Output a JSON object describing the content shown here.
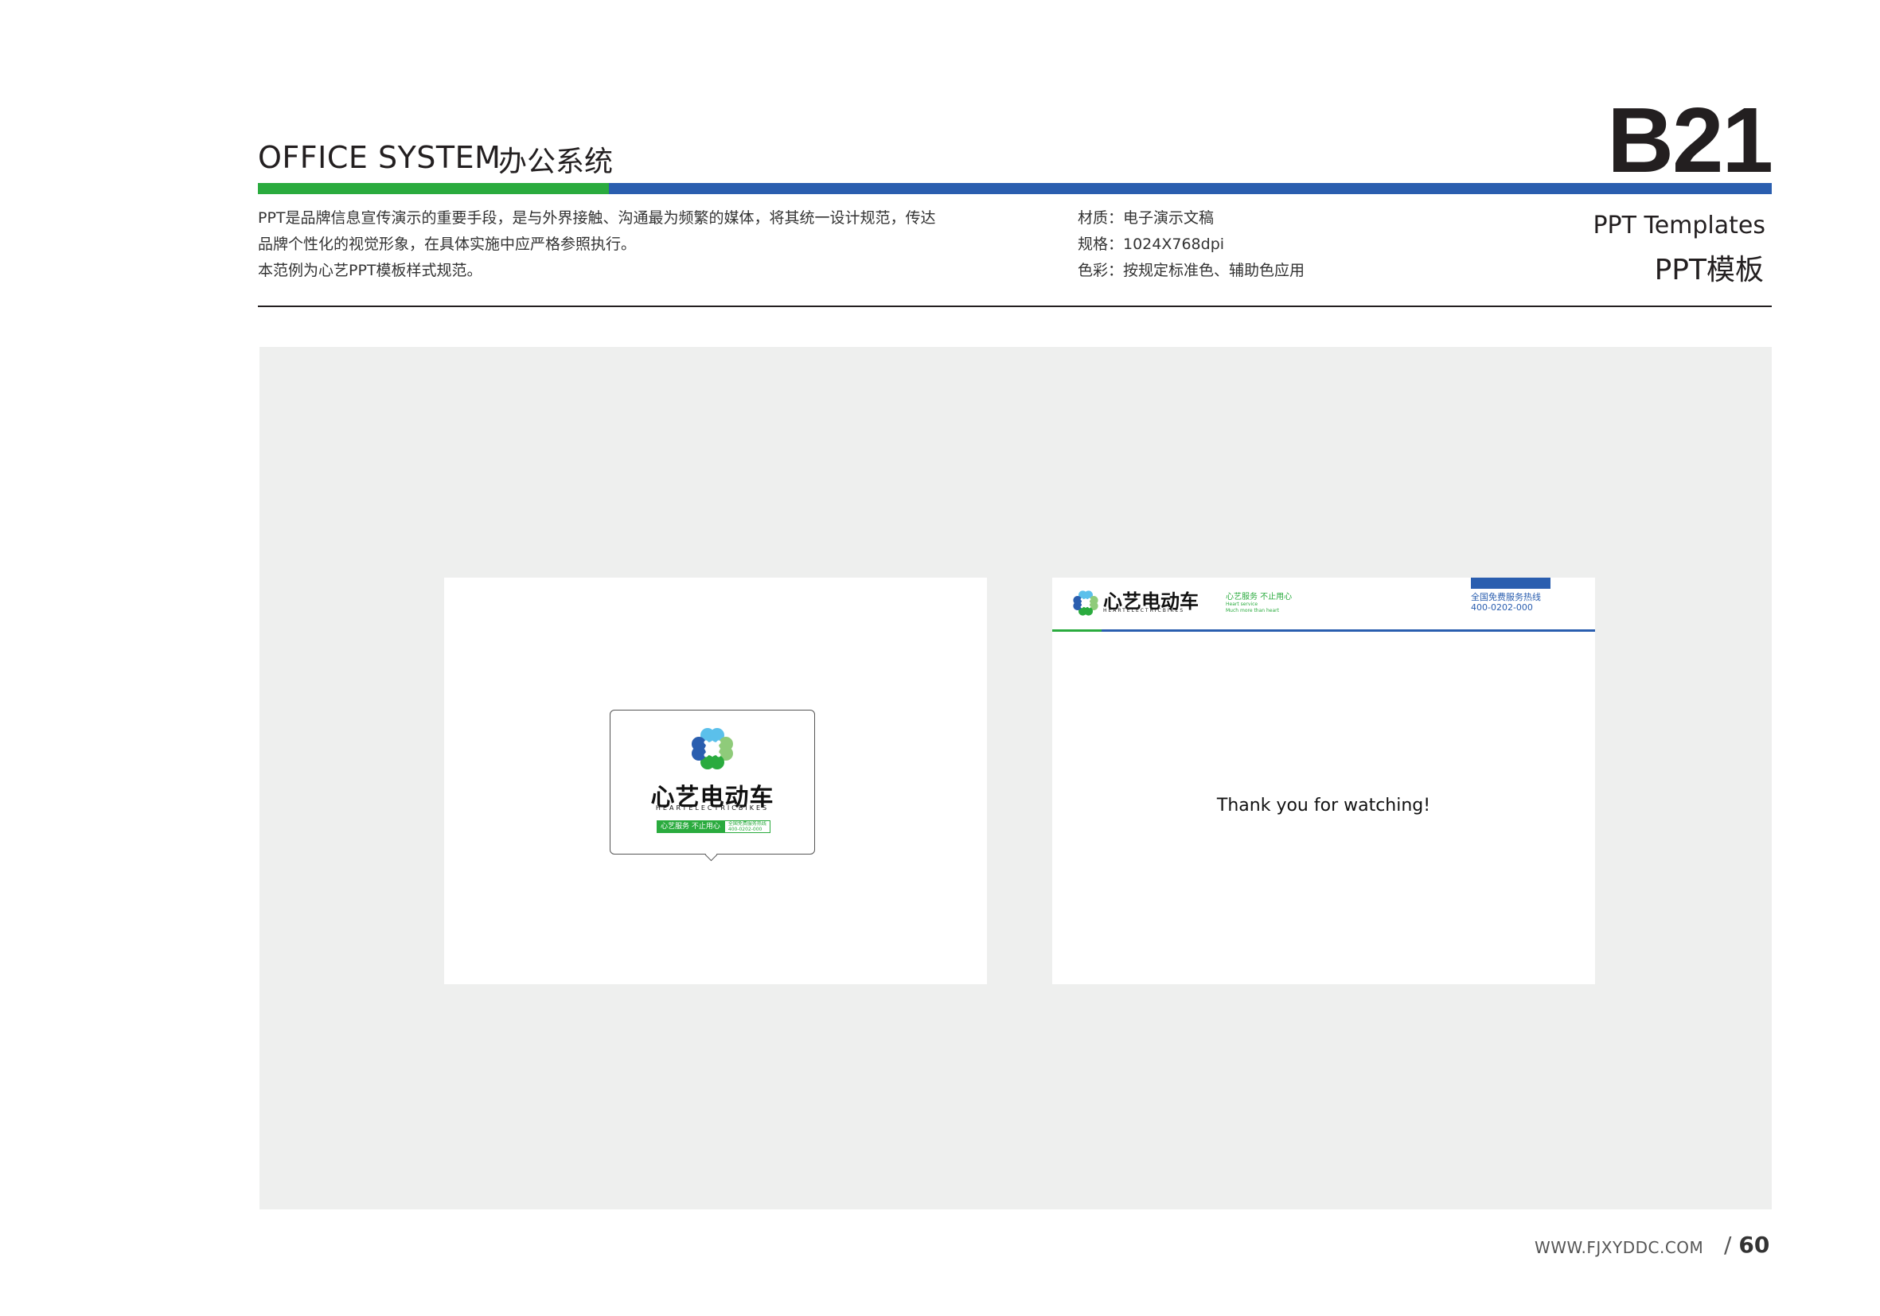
{
  "header": {
    "title_en": "OFFICE SYSTEM",
    "title_cn": "办公系统",
    "page_code": "B21",
    "category_en": "PPT Templates",
    "category_cn": "PPT模板"
  },
  "description": [
    "PPT是品牌信息宣传演示的重要手段，是与外界接触、沟通最为频繁的媒体，将其统一设计规范，传达",
    "品牌个性化的视觉形象，在具体实施中应严格参照执行。",
    "本范例为心艺PPT模板样式规范。"
  ],
  "specs": [
    "材质：电子演示文稿",
    "规格：1024X768dpi",
    "色彩：按规定标准色、辅助色应用"
  ],
  "brand": {
    "name_cn": "心艺电动车",
    "name_en": "HEARTELECTRICBIKES",
    "slogan": "心艺服务 不止用心",
    "slogan_en_1": "Heart service",
    "slogan_en_2": "Much more than heart",
    "hotline_label": "全国免费服务热线",
    "hotline_number": "400-0202-000"
  },
  "slide2": {
    "thanks": "Thank you for watching!"
  },
  "footer": {
    "url": "WWW.FJXYDDC.COM",
    "page_sep": "/",
    "page_number": "60"
  },
  "colors": {
    "brand_green": "#2aab3e",
    "brand_blue": "#2a5eaf",
    "stage_gray": "#eeefee"
  }
}
